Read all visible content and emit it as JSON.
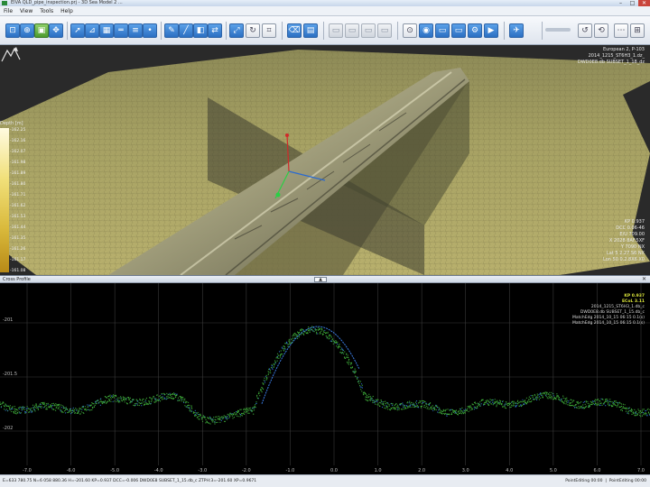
{
  "window": {
    "title": "EIVA QLD_pipe_inspection.prj - 3D Sea Model 2 ...",
    "controls": [
      "–",
      "□",
      "✕"
    ]
  },
  "menu": [
    "File",
    "View",
    "Tools",
    "Help"
  ],
  "toolbar": {
    "icons": [
      "select-icon",
      "zoom-icon",
      "fit-icon",
      "pan-icon",
      "cursor-icon",
      "measure-icon",
      "grid-icon",
      "ruler-icon",
      "layers-icon",
      "point-icon",
      "edit-icon",
      "line-icon",
      "fill-icon",
      "move-icon",
      "scale-icon",
      "rotate-icon",
      "crop-icon",
      "clean-icon",
      "view-front-icon",
      "view-top-icon",
      "view-side-icon",
      "view-iso-icon",
      "camera-icon",
      "lock-icon",
      "info-icon",
      "export-icon",
      "import-icon",
      "settings-icon",
      "run-icon",
      "help-icon"
    ]
  },
  "view3d": {
    "hud_top": [
      "European 2, P-103",
      "2014_1215_ST6H3_1.dz_",
      "DWD0E8.db SUBSET_1_18_dz"
    ],
    "hud_bottom": [
      "KP 0.937",
      "DCC 0.06-46",
      "E/U 709.00",
      "X 2028 8AF.5XF",
      "Y 7090 NX",
      "Lat 5 2.27.S6 NX",
      "Lon 50 0.2.8X6 X0"
    ],
    "depth_legend": {
      "title": "Depth [m]",
      "labels": [
        "-162.25",
        "-162.16",
        "-162.07",
        "-161.98",
        "-161.89",
        "-161.80",
        "-161.71",
        "-161.62",
        "-161.53",
        "-161.44",
        "-161.35",
        "-161.26",
        "-161.17",
        "-161.08"
      ]
    }
  },
  "cross_profile": {
    "title": "Cross Profile",
    "close": "✕",
    "grip": "▲",
    "legend": [
      "KP 0.937",
      "ECoL 3.11",
      "2014_1215_ST6H3_1.db_c",
      "DWD0E8.db SUBSET_1_15.db_c",
      "MatchEdg 2014_10_15 06:15 0.1(s)",
      "MatchEdg 2014_10_15 06:15 0.1(s)"
    ],
    "y_labels": [
      "-201",
      "-201.5",
      "-202"
    ],
    "x_labels": [
      "-7.0",
      "-6.0",
      "-5.0",
      "-4.0",
      "-3.0",
      "-2.0",
      "-1.0",
      "0.0",
      "1.0",
      "2.0",
      "3.0",
      "4.0",
      "5.0",
      "6.0",
      "7.0"
    ]
  },
  "status": {
    "left": "E=633 780.75 N=6 058 880.36 H=-201.60 KP=0.937 DCC=-0.006 DWD0E8 SUBSET_1_15.db_c ZTPH:3=-201.60 XP=0.9671",
    "right": [
      "PointEditing 00:00",
      "PointEditing 00:00"
    ]
  }
}
